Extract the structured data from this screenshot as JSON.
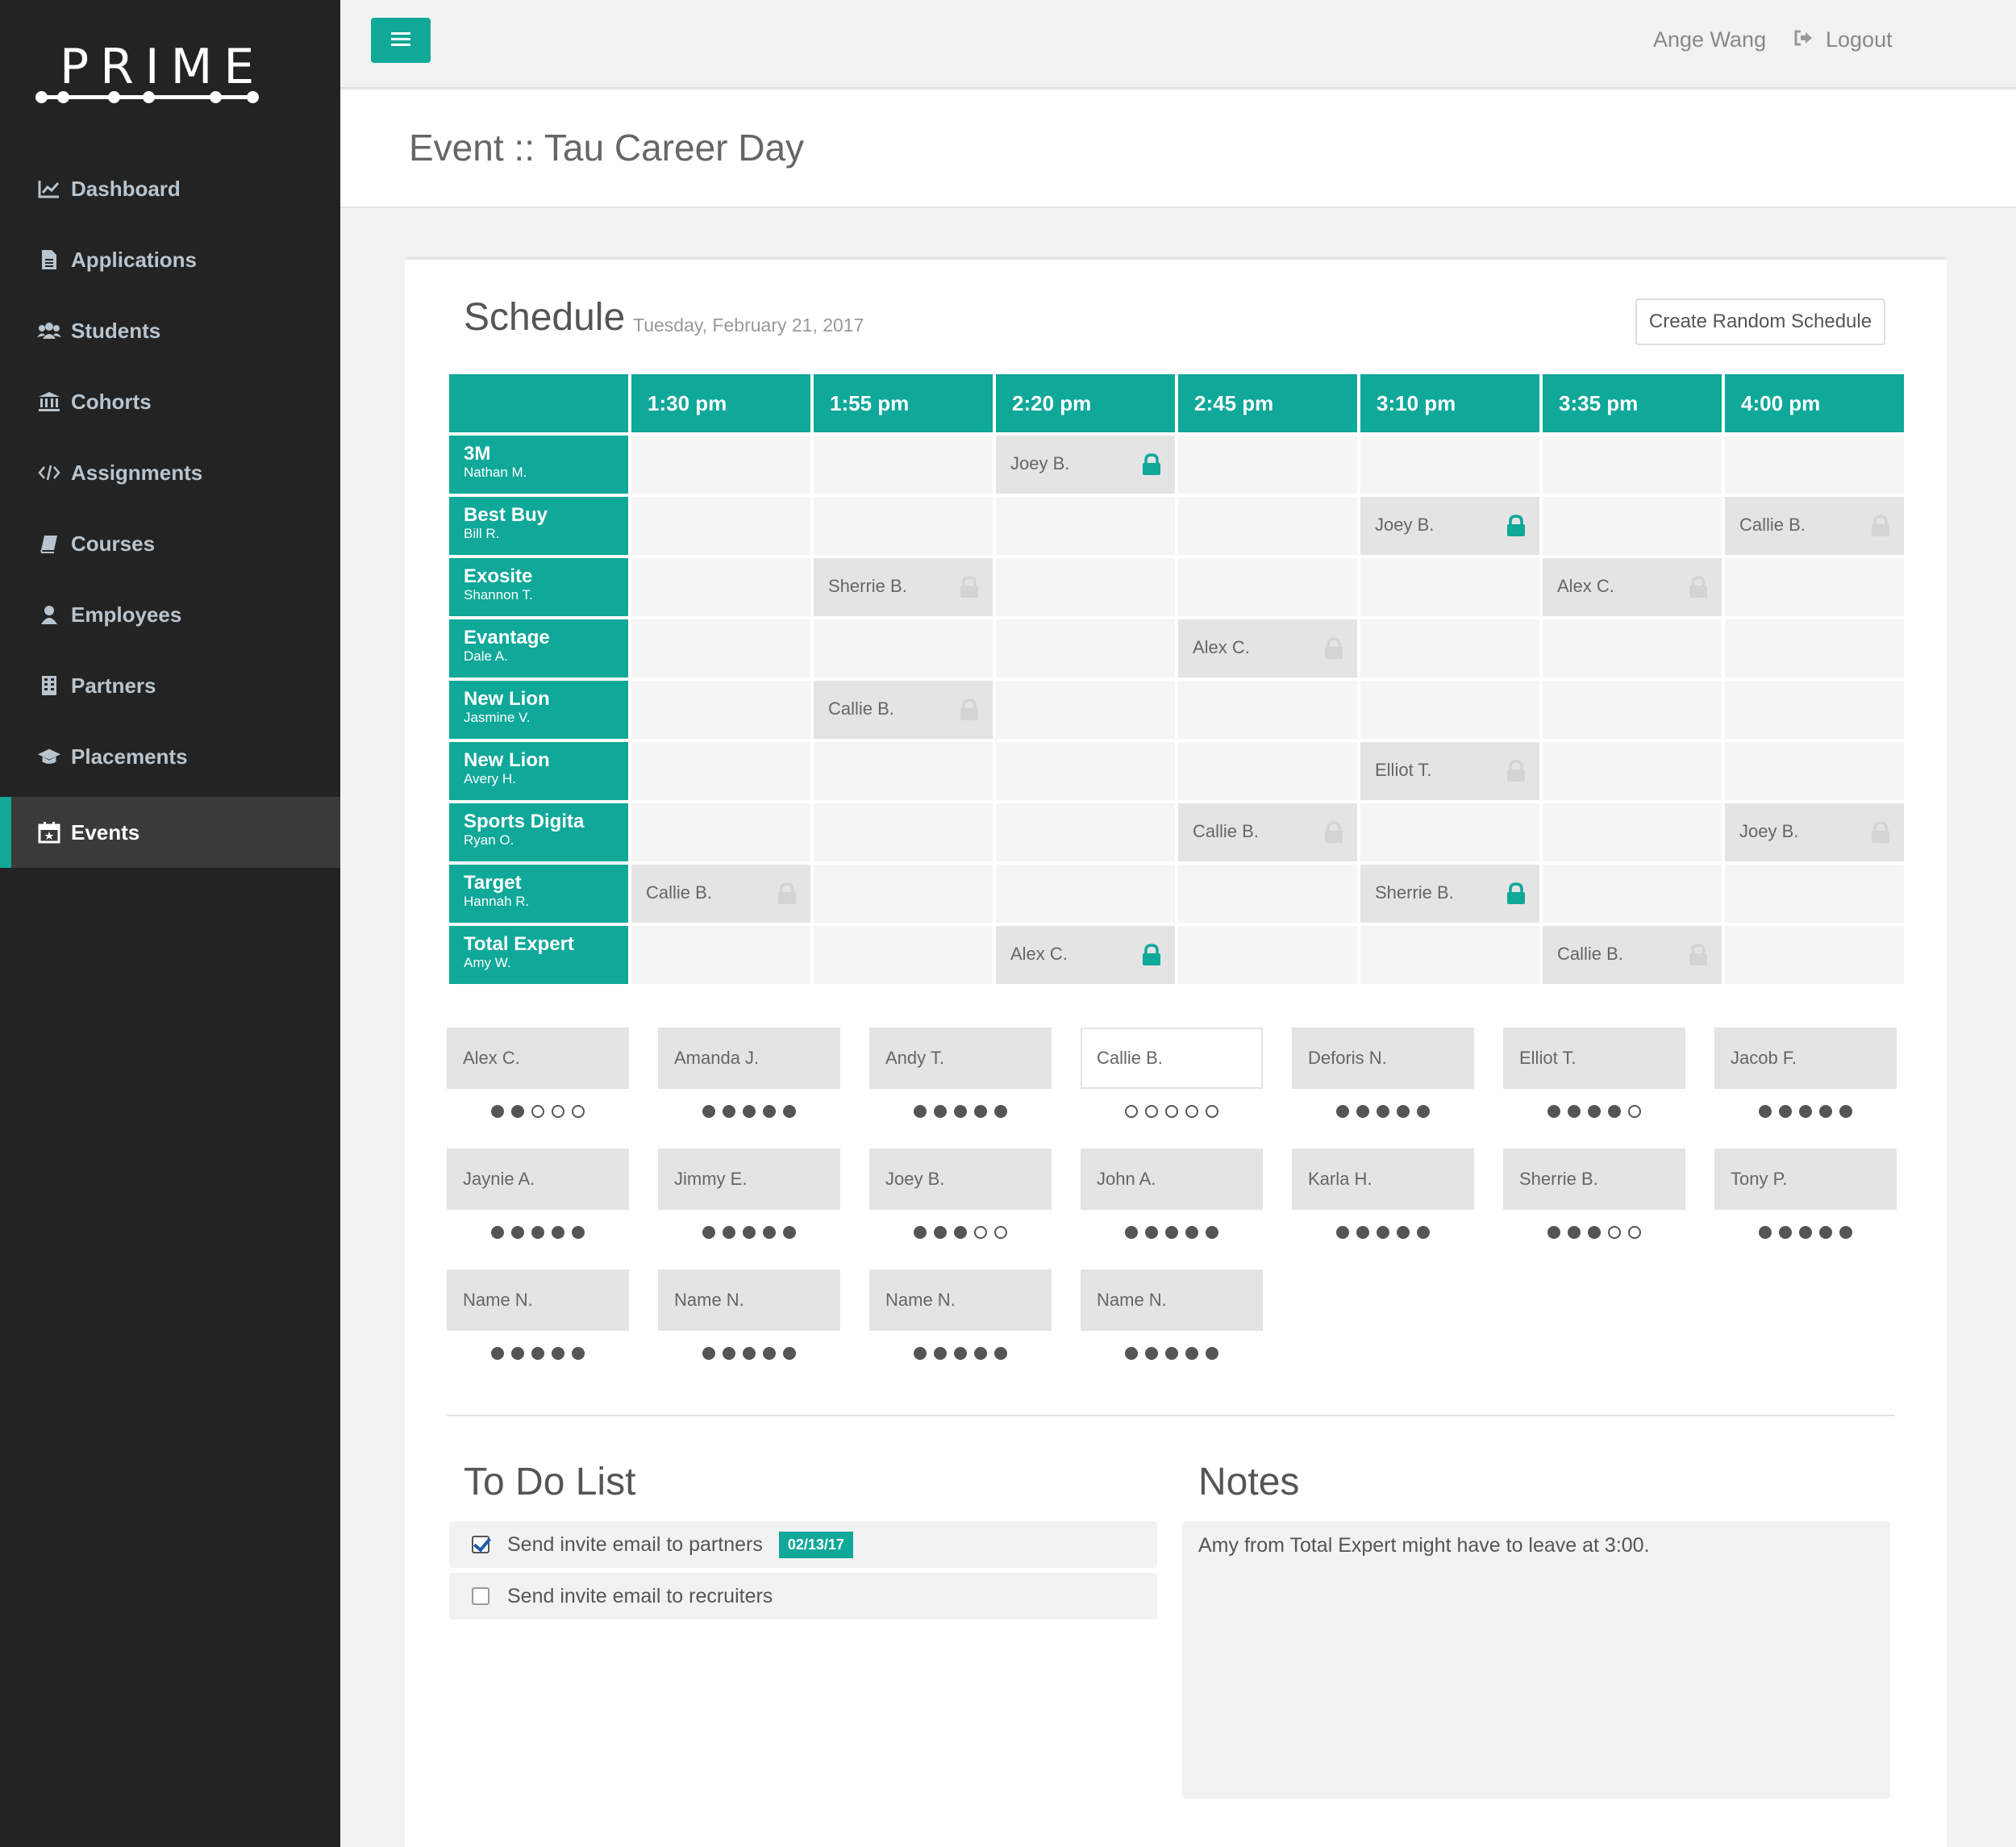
{
  "brand": {
    "logo_text": "PRIME"
  },
  "sidebar": {
    "items": [
      {
        "label": "Dashboard",
        "icon": "line-chart-icon"
      },
      {
        "label": "Applications",
        "icon": "document-icon"
      },
      {
        "label": "Students",
        "icon": "users-icon"
      },
      {
        "label": "Cohorts",
        "icon": "institution-icon"
      },
      {
        "label": "Assignments",
        "icon": "code-icon"
      },
      {
        "label": "Courses",
        "icon": "book-icon"
      },
      {
        "label": "Employees",
        "icon": "user-icon"
      },
      {
        "label": "Partners",
        "icon": "building-icon"
      },
      {
        "label": "Placements",
        "icon": "graduation-cap-icon"
      },
      {
        "label": "Events",
        "icon": "calendar-icon",
        "active": true
      }
    ]
  },
  "header": {
    "user_name": "Ange Wang",
    "logout_label": "Logout"
  },
  "page": {
    "title": "Event :: Tau Career Day"
  },
  "schedule": {
    "title": "Schedule",
    "date": "Tuesday, February 21, 2017",
    "random_button": "Create Random Schedule",
    "times": [
      "1:30 pm",
      "1:55 pm",
      "2:20 pm",
      "2:45 pm",
      "3:10 pm",
      "3:35 pm",
      "4:00 pm"
    ],
    "rows": [
      {
        "company": "3M",
        "contact": "Nathan M."
      },
      {
        "company": "Best Buy",
        "contact": "Bill R."
      },
      {
        "company": "Exosite",
        "contact": "Shannon T."
      },
      {
        "company": "Evantage",
        "contact": "Dale A."
      },
      {
        "company": "New Lion",
        "contact": "Jasmine V."
      },
      {
        "company": "New Lion",
        "contact": "Avery H."
      },
      {
        "company": "Sports Digita",
        "contact": "Ryan O."
      },
      {
        "company": "Target",
        "contact": "Hannah R."
      },
      {
        "company": "Total Expert",
        "contact": "Amy W."
      }
    ],
    "assignments": [
      {
        "row": 0,
        "col": 2,
        "name": "Joey B.",
        "locked": true
      },
      {
        "row": 1,
        "col": 4,
        "name": "Joey B.",
        "locked": true
      },
      {
        "row": 1,
        "col": 6,
        "name": "Callie B.",
        "locked": false
      },
      {
        "row": 2,
        "col": 1,
        "name": "Sherrie B.",
        "locked": false
      },
      {
        "row": 2,
        "col": 5,
        "name": "Alex C.",
        "locked": false
      },
      {
        "row": 3,
        "col": 3,
        "name": "Alex C.",
        "locked": false
      },
      {
        "row": 4,
        "col": 1,
        "name": "Callie B.",
        "locked": false
      },
      {
        "row": 5,
        "col": 4,
        "name": "Elliot T.",
        "locked": false
      },
      {
        "row": 6,
        "col": 3,
        "name": "Callie B.",
        "locked": false
      },
      {
        "row": 6,
        "col": 6,
        "name": "Joey B.",
        "locked": false
      },
      {
        "row": 7,
        "col": 0,
        "name": "Callie B.",
        "locked": false
      },
      {
        "row": 7,
        "col": 4,
        "name": "Sherrie B.",
        "locked": true
      },
      {
        "row": 8,
        "col": 2,
        "name": "Alex C.",
        "locked": true
      },
      {
        "row": 8,
        "col": 5,
        "name": "Callie B.",
        "locked": false
      }
    ],
    "colors": {
      "accent": "#0fa899",
      "lock_active": "#0fa899",
      "lock_inactive": "#d4d4d4"
    }
  },
  "students": [
    {
      "name": "Alex C.",
      "filled": 2
    },
    {
      "name": "Amanda J.",
      "filled": 5
    },
    {
      "name": "Andy T.",
      "filled": 5
    },
    {
      "name": "Callie B.",
      "filled": 0,
      "outlined": true
    },
    {
      "name": "Deforis N.",
      "filled": 5
    },
    {
      "name": "Elliot T.",
      "filled": 4
    },
    {
      "name": "Jacob F.",
      "filled": 5
    },
    {
      "name": "Jaynie A.",
      "filled": 5
    },
    {
      "name": "Jimmy E.",
      "filled": 5
    },
    {
      "name": "Joey B.",
      "filled": 3
    },
    {
      "name": "John A.",
      "filled": 5
    },
    {
      "name": "Karla H.",
      "filled": 5
    },
    {
      "name": "Sherrie B.",
      "filled": 3
    },
    {
      "name": "Tony P.",
      "filled": 5
    },
    {
      "name": "Name N.",
      "filled": 5
    },
    {
      "name": "Name N.",
      "filled": 5
    },
    {
      "name": "Name N.",
      "filled": 5
    },
    {
      "name": "Name N.",
      "filled": 5
    }
  ],
  "todo": {
    "title": "To Do List",
    "items": [
      {
        "label": "Send invite email to partners",
        "checked": true,
        "badge": "02/13/17"
      },
      {
        "label": "Send invite email to recruiters",
        "checked": false
      }
    ]
  },
  "notes": {
    "title": "Notes",
    "text": "Amy from Total Expert might have to leave at 3:00."
  }
}
